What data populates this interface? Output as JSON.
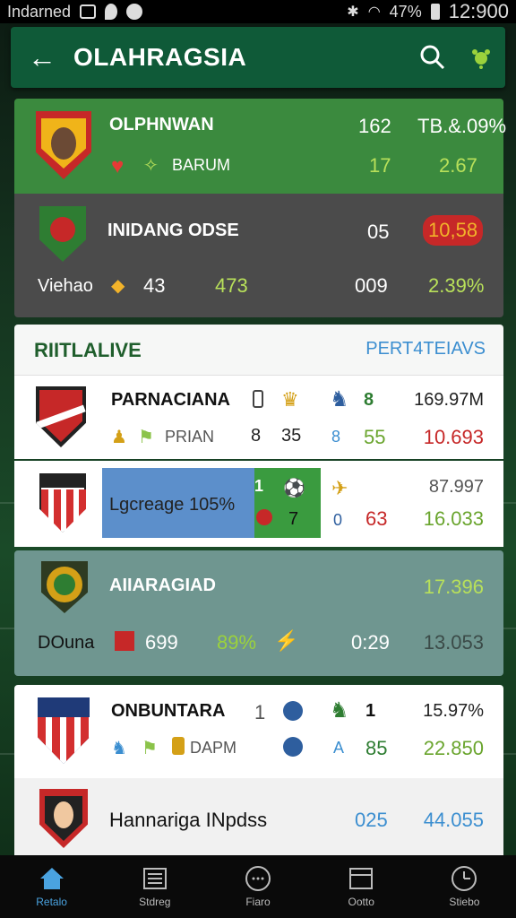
{
  "status_bar": {
    "carrier": "Indarned",
    "signal_text": "47%",
    "time": "12:900"
  },
  "app_bar": {
    "title": "OLAHRAGSIA"
  },
  "top_matches": [
    {
      "name": "OLPHNWAN",
      "sub": "BARUM",
      "v1": "162",
      "v2": "TB.&.09%",
      "v3": "17",
      "v4": "2.67"
    },
    {
      "name": "INIDANG ODSE",
      "sub": "Viehao",
      "v1": "05",
      "v2": "10,58",
      "v3": "009",
      "v4": "2.39%",
      "sub_num1": "43",
      "sub_num2": "473"
    }
  ],
  "live": {
    "title": "RIITLALIVE",
    "link": "PERT4TEIAVS",
    "rows": [
      {
        "name": "PARNACIANA",
        "sub": "PRIAN",
        "c1": "8",
        "c2": "35",
        "score": "8",
        "score2": "55",
        "v1": "169.97M",
        "v2": "10.693",
        "s_small": "8"
      },
      {
        "name": "Lgcreage 105%",
        "c1": "1",
        "c2": "7",
        "score": "0",
        "score2": "63",
        "v1": "87.997",
        "v2": "16.033"
      },
      {
        "name": "AIIARAGIAD",
        "sub": "DOuna",
        "c1": "699",
        "c2": "89%",
        "v1": "17.396",
        "v2": "13.053",
        "score2": "0:29"
      },
      {
        "name": "ONBUNTARA",
        "sub": "DAPM",
        "c1": "1",
        "score": "1",
        "score2": "A",
        "score3": "85",
        "v1": "15.97%",
        "v2": "22.850"
      },
      {
        "name": "Hannariga INpdss",
        "v1": "025",
        "v2": "44.055"
      }
    ]
  },
  "bottom_nav": [
    {
      "label": "Retalo",
      "icon": "home-icon"
    },
    {
      "label": "Stdreg",
      "icon": "news-icon"
    },
    {
      "label": "Fiaro",
      "icon": "circle-menu-icon"
    },
    {
      "label": "Ootto",
      "icon": "calendar-icon"
    },
    {
      "label": "Stiebo",
      "icon": "clock-icon"
    }
  ],
  "colors": {
    "brand": "#0f5a38",
    "accent_green": "#9bd23c",
    "accent_red": "#c62828",
    "accent_blue": "#3b8ed0"
  }
}
